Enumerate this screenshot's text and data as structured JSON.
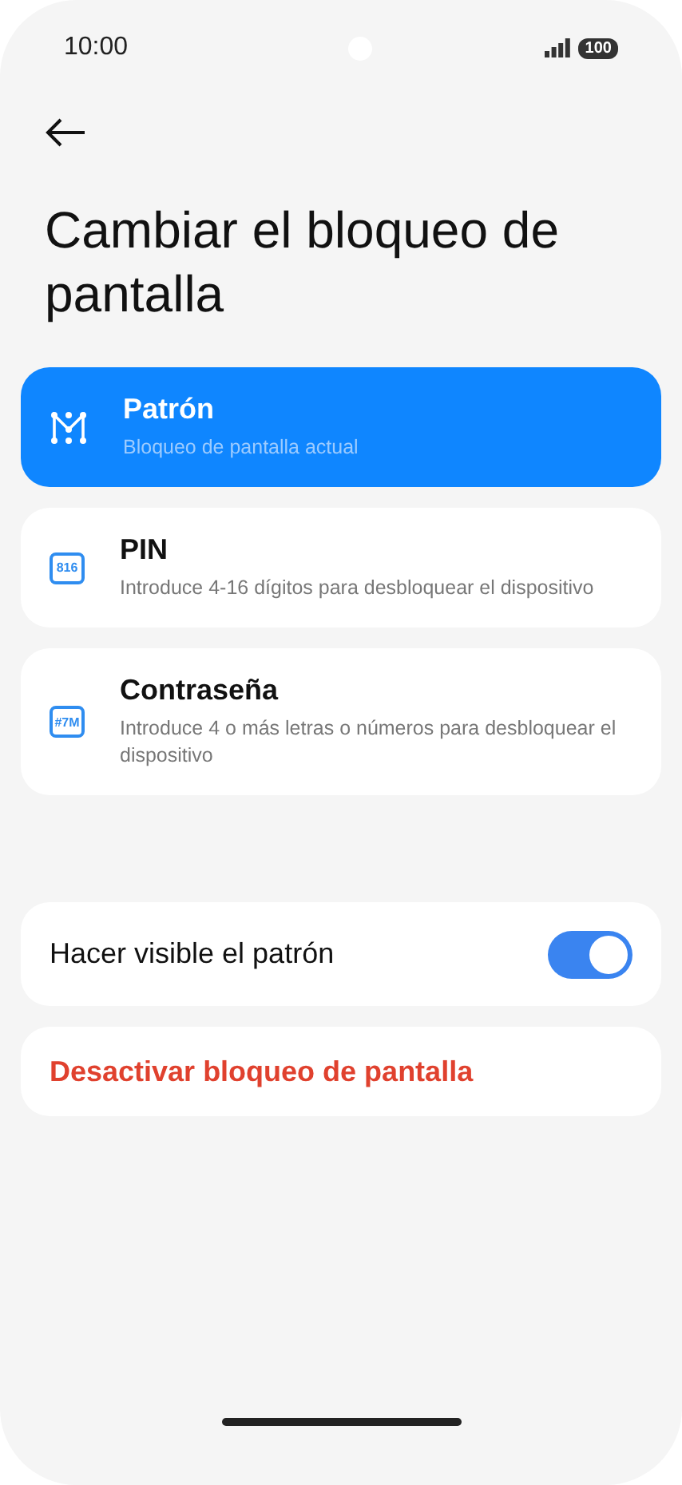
{
  "status_bar": {
    "time": "10:00",
    "battery": "100"
  },
  "title": "Cambiar el bloqueo de pantalla",
  "options": [
    {
      "kind": "pattern",
      "title": "Patrón",
      "subtitle": "Bloqueo de pantalla actual",
      "selected": true
    },
    {
      "kind": "pin",
      "icon_text": "816",
      "title": "PIN",
      "subtitle": "Introduce 4-16 dígitos para desbloquear el dispositivo",
      "selected": false
    },
    {
      "kind": "password",
      "icon_text": "#7M",
      "title": "Contraseña",
      "subtitle": "Introduce 4 o más letras o números para desbloquear el dispositivo",
      "selected": false
    }
  ],
  "visible_pattern": {
    "label": "Hacer visible el patrón",
    "on": true
  },
  "disable_action": {
    "label": "Desactivar bloqueo de pantalla"
  }
}
